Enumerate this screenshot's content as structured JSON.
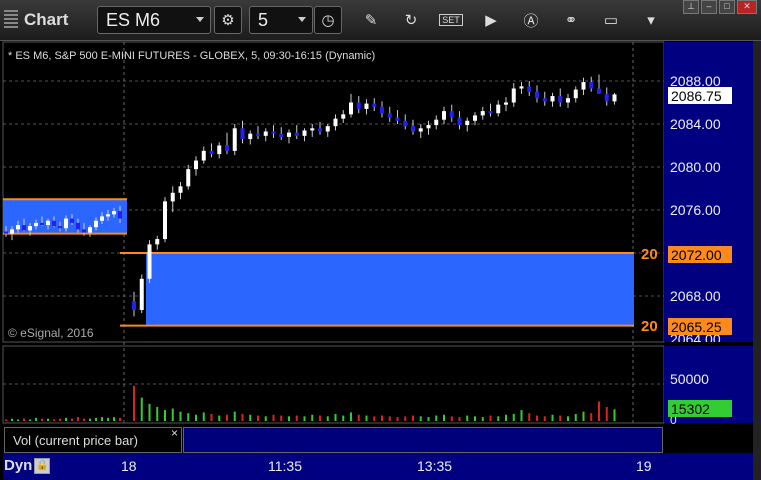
{
  "toolbar": {
    "app_label": "Chart",
    "symbol": "ES M6",
    "interval": "5"
  },
  "chart": {
    "title": "* ES M6, S&P 500 E-MINI FUTURES - GLOBEX, 5, 09:30-16:15 (Dynamic)",
    "copyright": "© eSignal, 2016",
    "price_axis": [
      "2088.00",
      "2084.00",
      "2080.00",
      "2076.00",
      "2068.00",
      "2064.00"
    ],
    "current_price": "2086.75",
    "zone_top_price": "2072.00",
    "zone_bottom_price": "2065.25",
    "zone_top_label": "20",
    "zone_bottom_label": "20",
    "volume_axis": [
      "50000",
      "0"
    ],
    "current_volume": "15302",
    "volume_study_label": "Vol (current price bar)",
    "close_symbol": "×",
    "time_axis": [
      "18",
      "11:35",
      "13:35",
      "19"
    ],
    "mode_label": "Dyn",
    "colors": {
      "up_bar": "#ffffff",
      "down_bar": "#2222ee",
      "zone_fill": "#2a66ff",
      "zone_line": "#ff8a1c",
      "axis_bg": "#000080",
      "vol_up": "#33cc33",
      "vol_down": "#dd2222"
    }
  },
  "chart_data": {
    "type": "candlestick",
    "ylim": [
      2064,
      2090
    ],
    "candles": [
      [
        2074.0,
        2074.5,
        2073.5,
        2073.8
      ],
      [
        2073.8,
        2074.5,
        2073.2,
        2074.2
      ],
      [
        2074.2,
        2075.0,
        2073.9,
        2074.6
      ],
      [
        2074.6,
        2075.2,
        2074.0,
        2074.1
      ],
      [
        2074.1,
        2074.8,
        2073.6,
        2074.5
      ],
      [
        2074.5,
        2075.1,
        2074.2,
        2074.8
      ],
      [
        2074.8,
        2075.4,
        2074.5,
        2074.6
      ],
      [
        2074.6,
        2075.2,
        2074.2,
        2075.0
      ],
      [
        2075.0,
        2075.4,
        2074.4,
        2074.5
      ],
      [
        2074.5,
        2074.9,
        2074.0,
        2074.3
      ],
      [
        2074.3,
        2075.5,
        2074.0,
        2075.2
      ],
      [
        2075.2,
        2075.6,
        2074.6,
        2074.8
      ],
      [
        2074.8,
        2075.2,
        2073.9,
        2074.2
      ],
      [
        2074.2,
        2074.8,
        2073.6,
        2073.9
      ],
      [
        2073.9,
        2074.6,
        2073.5,
        2074.4
      ],
      [
        2074.4,
        2075.3,
        2074.1,
        2075.0
      ],
      [
        2075.0,
        2075.8,
        2074.7,
        2075.4
      ],
      [
        2075.4,
        2076.0,
        2075.0,
        2075.6
      ],
      [
        2075.6,
        2076.2,
        2075.3,
        2075.9
      ],
      [
        2075.9,
        2076.4,
        2074.8,
        2075.2
      ],
      [
        2067.5,
        2068.4,
        2066.1,
        2066.7
      ],
      [
        2066.7,
        2070.0,
        2066.4,
        2069.6
      ],
      [
        2069.6,
        2073.2,
        2069.2,
        2072.8
      ],
      [
        2072.8,
        2073.6,
        2072.3,
        2073.3
      ],
      [
        2073.3,
        2077.2,
        2073.0,
        2076.8
      ],
      [
        2076.8,
        2078.2,
        2075.8,
        2077.6
      ],
      [
        2077.6,
        2078.6,
        2077.0,
        2078.2
      ],
      [
        2078.2,
        2080.2,
        2077.9,
        2079.8
      ],
      [
        2079.8,
        2081.0,
        2079.2,
        2080.6
      ],
      [
        2080.6,
        2081.9,
        2080.3,
        2081.5
      ],
      [
        2081.5,
        2082.2,
        2080.9,
        2081.2
      ],
      [
        2081.2,
        2082.3,
        2080.8,
        2082.0
      ],
      [
        2082.0,
        2083.2,
        2081.2,
        2081.5
      ],
      [
        2081.5,
        2084.0,
        2081.1,
        2083.6
      ],
      [
        2083.6,
        2084.3,
        2082.2,
        2082.6
      ],
      [
        2082.6,
        2083.4,
        2082.1,
        2083.1
      ],
      [
        2083.1,
        2083.8,
        2082.6,
        2082.9
      ],
      [
        2082.9,
        2083.6,
        2082.4,
        2083.3
      ],
      [
        2083.3,
        2083.9,
        2082.7,
        2083.1
      ],
      [
        2083.1,
        2083.7,
        2082.5,
        2082.8
      ],
      [
        2082.8,
        2083.5,
        2082.2,
        2083.2
      ],
      [
        2083.2,
        2083.9,
        2082.6,
        2082.9
      ],
      [
        2082.9,
        2083.6,
        2082.4,
        2083.4
      ],
      [
        2083.4,
        2084.0,
        2082.8,
        2083.6
      ],
      [
        2083.6,
        2084.2,
        2083.0,
        2083.3
      ],
      [
        2083.3,
        2084.0,
        2082.8,
        2083.8
      ],
      [
        2083.8,
        2084.9,
        2083.4,
        2084.5
      ],
      [
        2084.5,
        2085.3,
        2084.1,
        2084.9
      ],
      [
        2084.9,
        2086.8,
        2084.6,
        2086.0
      ],
      [
        2086.0,
        2086.6,
        2085.0,
        2085.4
      ],
      [
        2085.4,
        2086.3,
        2084.9,
        2085.9
      ],
      [
        2085.9,
        2086.4,
        2085.2,
        2085.6
      ],
      [
        2085.6,
        2086.1,
        2084.6,
        2085.0
      ],
      [
        2085.0,
        2085.6,
        2084.2,
        2084.6
      ],
      [
        2084.6,
        2085.3,
        2084.0,
        2084.3
      ],
      [
        2084.3,
        2084.9,
        2083.5,
        2083.8
      ],
      [
        2083.8,
        2084.4,
        2083.0,
        2083.3
      ],
      [
        2083.3,
        2084.0,
        2082.7,
        2083.6
      ],
      [
        2083.6,
        2084.3,
        2083.0,
        2083.9
      ],
      [
        2083.9,
        2084.8,
        2083.5,
        2084.4
      ],
      [
        2084.4,
        2085.6,
        2084.0,
        2085.2
      ],
      [
        2085.2,
        2085.8,
        2084.2,
        2084.6
      ],
      [
        2084.6,
        2085.2,
        2083.5,
        2083.9
      ],
      [
        2083.9,
        2084.6,
        2083.3,
        2084.3
      ],
      [
        2084.3,
        2085.1,
        2083.9,
        2084.8
      ],
      [
        2084.8,
        2085.6,
        2084.4,
        2085.2
      ],
      [
        2085.2,
        2085.9,
        2084.7,
        2085.0
      ],
      [
        2085.0,
        2086.2,
        2084.7,
        2085.8
      ],
      [
        2085.8,
        2086.5,
        2085.2,
        2086.0
      ],
      [
        2086.0,
        2087.8,
        2085.6,
        2087.3
      ],
      [
        2087.3,
        2087.9,
        2086.8,
        2087.5
      ],
      [
        2087.5,
        2088.0,
        2086.6,
        2087.0
      ],
      [
        2087.0,
        2087.6,
        2086.0,
        2086.4
      ],
      [
        2086.4,
        2087.0,
        2085.7,
        2086.1
      ],
      [
        2086.1,
        2086.9,
        2085.6,
        2086.6
      ],
      [
        2086.6,
        2087.3,
        2085.6,
        2086.0
      ],
      [
        2086.0,
        2086.8,
        2085.5,
        2086.4
      ],
      [
        2086.4,
        2087.5,
        2086.0,
        2087.2
      ],
      [
        2087.2,
        2088.3,
        2086.7,
        2087.9
      ],
      [
        2087.9,
        2088.4,
        2087.0,
        2087.3
      ],
      [
        2087.3,
        2088.6,
        2086.8,
        2086.8
      ],
      [
        2086.8,
        2087.4,
        2085.7,
        2086.1
      ],
      [
        2086.1,
        2086.9,
        2085.8,
        2086.75
      ]
    ],
    "volumes": [
      2,
      3,
      2,
      3,
      2,
      4,
      3,
      3,
      2,
      3,
      4,
      3,
      5,
      3,
      3,
      4,
      5,
      4,
      5,
      4,
      45,
      30,
      22,
      18,
      14,
      16,
      12,
      10,
      8,
      11,
      9,
      7,
      8,
      12,
      9,
      8,
      7,
      6,
      8,
      7,
      6,
      7,
      6,
      8,
      7,
      6,
      9,
      7,
      11,
      8,
      7,
      6,
      7,
      6,
      5,
      6,
      7,
      6,
      5,
      7,
      8,
      6,
      5,
      7,
      6,
      5,
      7,
      6,
      8,
      9,
      14,
      10,
      7,
      6,
      8,
      7,
      6,
      9,
      12,
      10,
      25,
      18,
      15
    ],
    "zone_top": 2072.0,
    "zone_bottom": 2065.25,
    "prior_zone_top": 2077.0,
    "prior_zone_bottom": 2073.8
  }
}
